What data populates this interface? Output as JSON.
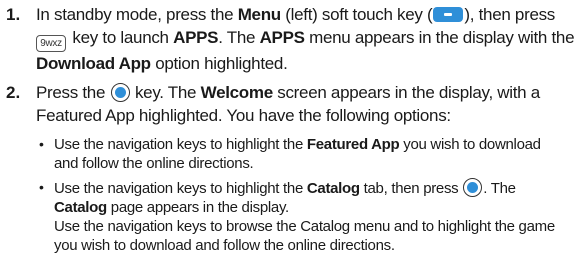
{
  "step1": {
    "num": "1.",
    "t1": "In standby mode, press the ",
    "b1": "Menu",
    "t2": " (left) soft touch key (",
    "t3": "), then press",
    "t4": " key to launch ",
    "b2": "APPS",
    "t5": ". The ",
    "b3": "APPS",
    "t6": " menu appears in the display with the",
    "b4": "Download App",
    "t7": " option highlighted.",
    "key_label": "9wxz"
  },
  "step2": {
    "num": "2.",
    "t1": "Press the ",
    "t2": " key. The ",
    "b1": "Welcome",
    "t3": " screen appears in the display, with a",
    "t4": "Featured App highlighted. You have the following options:"
  },
  "bullets": {
    "item1": {
      "t1": "Use the navigation keys to highlight the ",
      "b1": "Featured App",
      "t2": " you wish to download",
      "t3": "and follow the online directions."
    },
    "item2": {
      "t1": "Use the navigation keys to highlight the ",
      "b1": "Catalog",
      "t2": " tab, then press ",
      "t3": ". The",
      "b2": "Catalog",
      "t4": " page appears in the display.",
      "t5": "Use the navigation keys to browse the Catalog menu and to highlight the game",
      "t6": "you wish to download and follow the online directions."
    }
  },
  "icons": {
    "softkey": "menu-softkey-icon",
    "key9": "key-9-icon",
    "ok": "ok-key-icon"
  },
  "colors": {
    "accent": "#2f8fd8",
    "text": "#1a1a1a"
  }
}
